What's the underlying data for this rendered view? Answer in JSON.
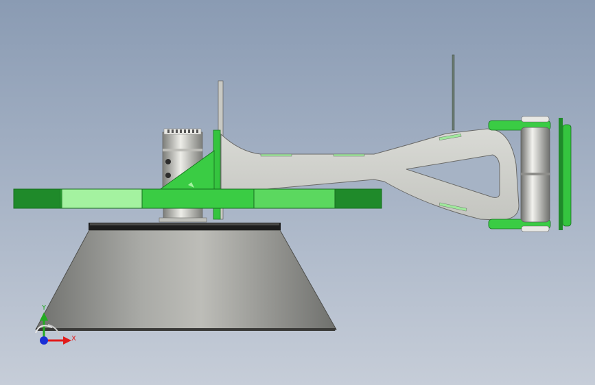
{
  "viewport": {
    "background_top": "#8a9bb3",
    "background_bottom": "#c6cdd8"
  },
  "model": {
    "part_colors": {
      "green_dark": "#1f8a2a",
      "green_mid": "#35c43f",
      "green_light": "#a4f2a0",
      "metal_light": "#d7d7d2",
      "metal_mid": "#a9aaa6",
      "metal_dark": "#6f706d"
    }
  },
  "triad": {
    "x_label": "X",
    "y_label": "Y",
    "x_color": "#e11b1b",
    "y_color": "#22aa22",
    "z_color": "#1a2fd6"
  }
}
